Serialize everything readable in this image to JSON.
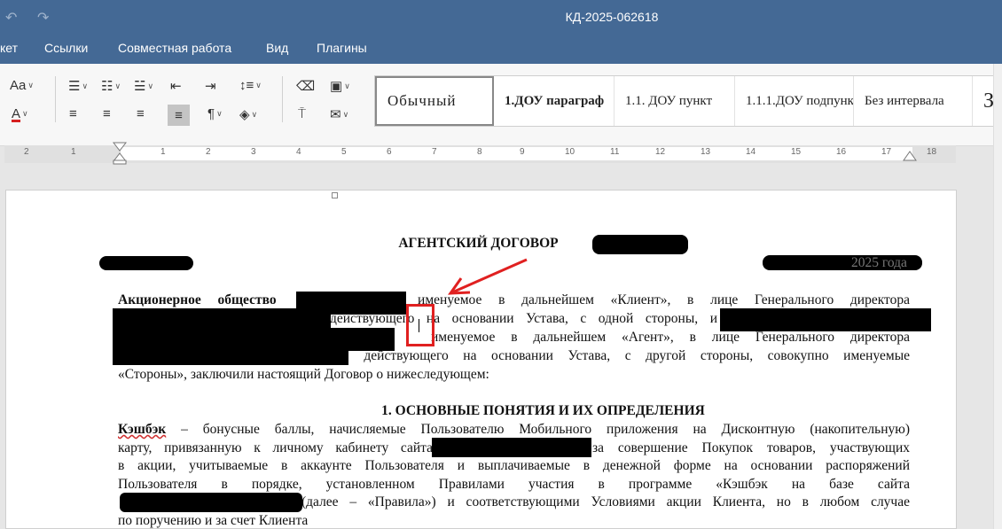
{
  "window": {
    "title": "КД-2025-062618"
  },
  "menu": {
    "items": [
      "кет",
      "Ссылки",
      "Совместная работа",
      "Вид",
      "Плагины"
    ]
  },
  "ribbon": {
    "font_size_label": "Aa",
    "font_color_label": "A",
    "styles": [
      "Обычный",
      "1.ДОУ параграф",
      "1.1. ДОУ пункт",
      "1.1.1.ДОУ подпункт",
      "Без интервала",
      "З"
    ]
  },
  "ruler": {
    "labels": [
      "2",
      "1",
      "1",
      "2",
      "3",
      "4",
      "5",
      "6",
      "7",
      "8",
      "9",
      "10",
      "11",
      "12",
      "13",
      "14",
      "15",
      "16",
      "17",
      "18"
    ]
  },
  "document": {
    "title": "АГЕНТСКИЙ ДОГОВОР",
    "date_suffix": "2025 года",
    "p1": [
      "Акционерное общество",
      "именуемое в дальнейшем «Клиент», в лице Генерального директора",
      "действующего на основании Устава, с одной стороны, и",
      "именуемое в дальнейшем «Агент», в лице Генерального директора",
      ", действующего на основании Устава, с другой стороны, совокупно именуемые",
      "«Стороны», заключили настоящий Договор о нижеследующем:"
    ],
    "section1": "1. ОСНОВНЫЕ ПОНЯТИЯ И ИХ ОПРЕДЕЛЕНИЯ",
    "p2": {
      "term": "Кэшбэк",
      "l1": " – бонусные баллы, начисляемые Пользователю Мобильного приложения на Дисконтную (накопительную)",
      "l2a": "карту, привязанную к личному кабинету сайта",
      "l2b": "за совершение Покупок товаров, участвующих",
      "l3": "в акции, учитываемые в аккаунте Пользователя и выплачиваемые в денежной форме на основании распоряжений",
      "l4": "Пользователя в порядке, установленном Правилами участия в программе «Кэшбэк на базе сайта",
      "l5": "(далее – «Правила») и соответствующими Условиями акции Клиента, но в любом случае",
      "l6": "по поручению и за счет Клиента"
    }
  },
  "colors": {
    "titlebar": "#446995",
    "annotation": "#e02020"
  }
}
